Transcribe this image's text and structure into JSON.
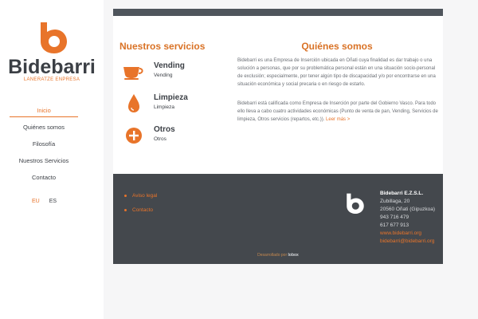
{
  "brand": {
    "name": "Bidebarri",
    "tagline": "LANERATZE ENPRESA",
    "accent": "#e8742a"
  },
  "nav": {
    "items": [
      "Inicio",
      "Quiénes somos",
      "Filosofía",
      "Nuestros Servicios",
      "Contacto"
    ]
  },
  "lang": {
    "eu": "EU",
    "es": "ES"
  },
  "services": {
    "title": "Nuestros servicios",
    "items": [
      {
        "name": "Vending",
        "sub": "Vending",
        "icon": "cup-icon"
      },
      {
        "name": "Limpieza",
        "sub": "Limpieza",
        "icon": "drop-icon"
      },
      {
        "name": "Otros",
        "sub": "Otros",
        "icon": "plus-icon"
      }
    ]
  },
  "about": {
    "title": "Quiénes somos",
    "p1": "Bidebarri es una Empresa de Inserción ubicada en Oñati cuya finalidad es dar trabajo o una solución a personas, que por su problemática personal están en una situación socio-personal de exclusión; especialmente, por tener algún tipo de discapacidad y/o por encontrarse en una situación económica y social precaria o en riesgo de estarlo.",
    "p2": "Bidebarri está calificada como Empresa de Inserción por parte del Gobierno Vasco. Para todo ello lleva a cabo cuatro actividades económicas (Punto de venta de pan, Vending, Servicios de limpieza, Otros servicios (repartos, etc.)).",
    "more": "Leer más >"
  },
  "footer": {
    "links": [
      "Aviso legal",
      "Contacto"
    ],
    "company": "Bidebarri E.Z.S.L.",
    "street": "Zubillaga, 20",
    "city": "20560 Oñati (Gipuzkoa)",
    "phone1": "943 716 479",
    "phone2": "617 677 913",
    "web": "www.bidebarri.org",
    "email": "bidebarri@bidebarri.org",
    "credit_prefix": "Desarrollado por",
    "credit_name": "lobox"
  }
}
